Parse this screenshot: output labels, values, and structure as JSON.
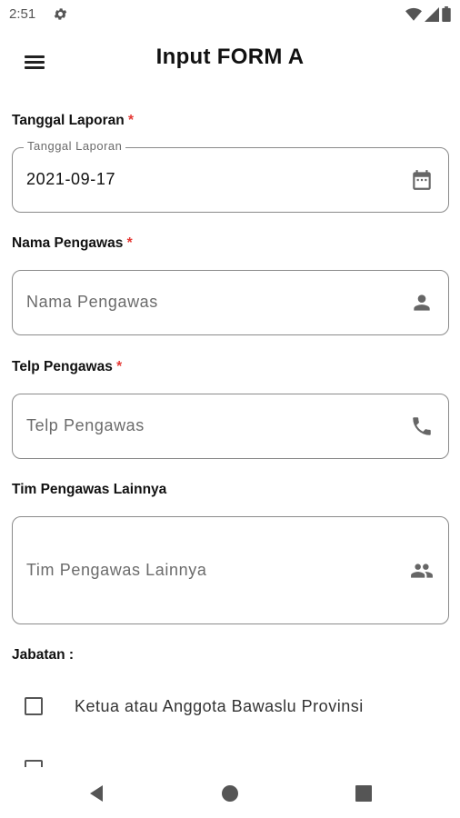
{
  "status_bar": {
    "time": "2:51",
    "icons": [
      "gear-icon",
      "wifi-icon",
      "signal-icon",
      "battery-icon"
    ]
  },
  "app_bar": {
    "title": "Input FORM A",
    "menu_icon": "hamburger-menu-icon"
  },
  "form": {
    "tanggal_laporan": {
      "label": "Tanggal Laporan",
      "required_mark": "*",
      "floating_label": "Tanggal Laporan",
      "value": "2021-09-17",
      "icon": "calendar-icon"
    },
    "nama_pengawas": {
      "label": "Nama Pengawas",
      "required_mark": "*",
      "placeholder": "Nama Pengawas",
      "icon": "person-icon"
    },
    "telp_pengawas": {
      "label": "Telp Pengawas",
      "required_mark": "*",
      "placeholder": "Telp Pengawas",
      "icon": "phone-icon"
    },
    "tim_pengawas_lainnya": {
      "label": "Tim Pengawas Lainnya",
      "placeholder": "Tim Pengawas Lainnya",
      "icon": "group-icon"
    },
    "jabatan": {
      "label": "Jabatan :",
      "options": [
        {
          "label": "Ketua atau Anggota Bawaslu Provinsi",
          "checked": false
        }
      ]
    }
  },
  "nav_bar": {
    "buttons": [
      "back-icon",
      "home-icon",
      "recents-icon"
    ]
  },
  "colors": {
    "required": "#e53935",
    "border": "#8a8a8a",
    "placeholder": "#6b6b6b"
  }
}
